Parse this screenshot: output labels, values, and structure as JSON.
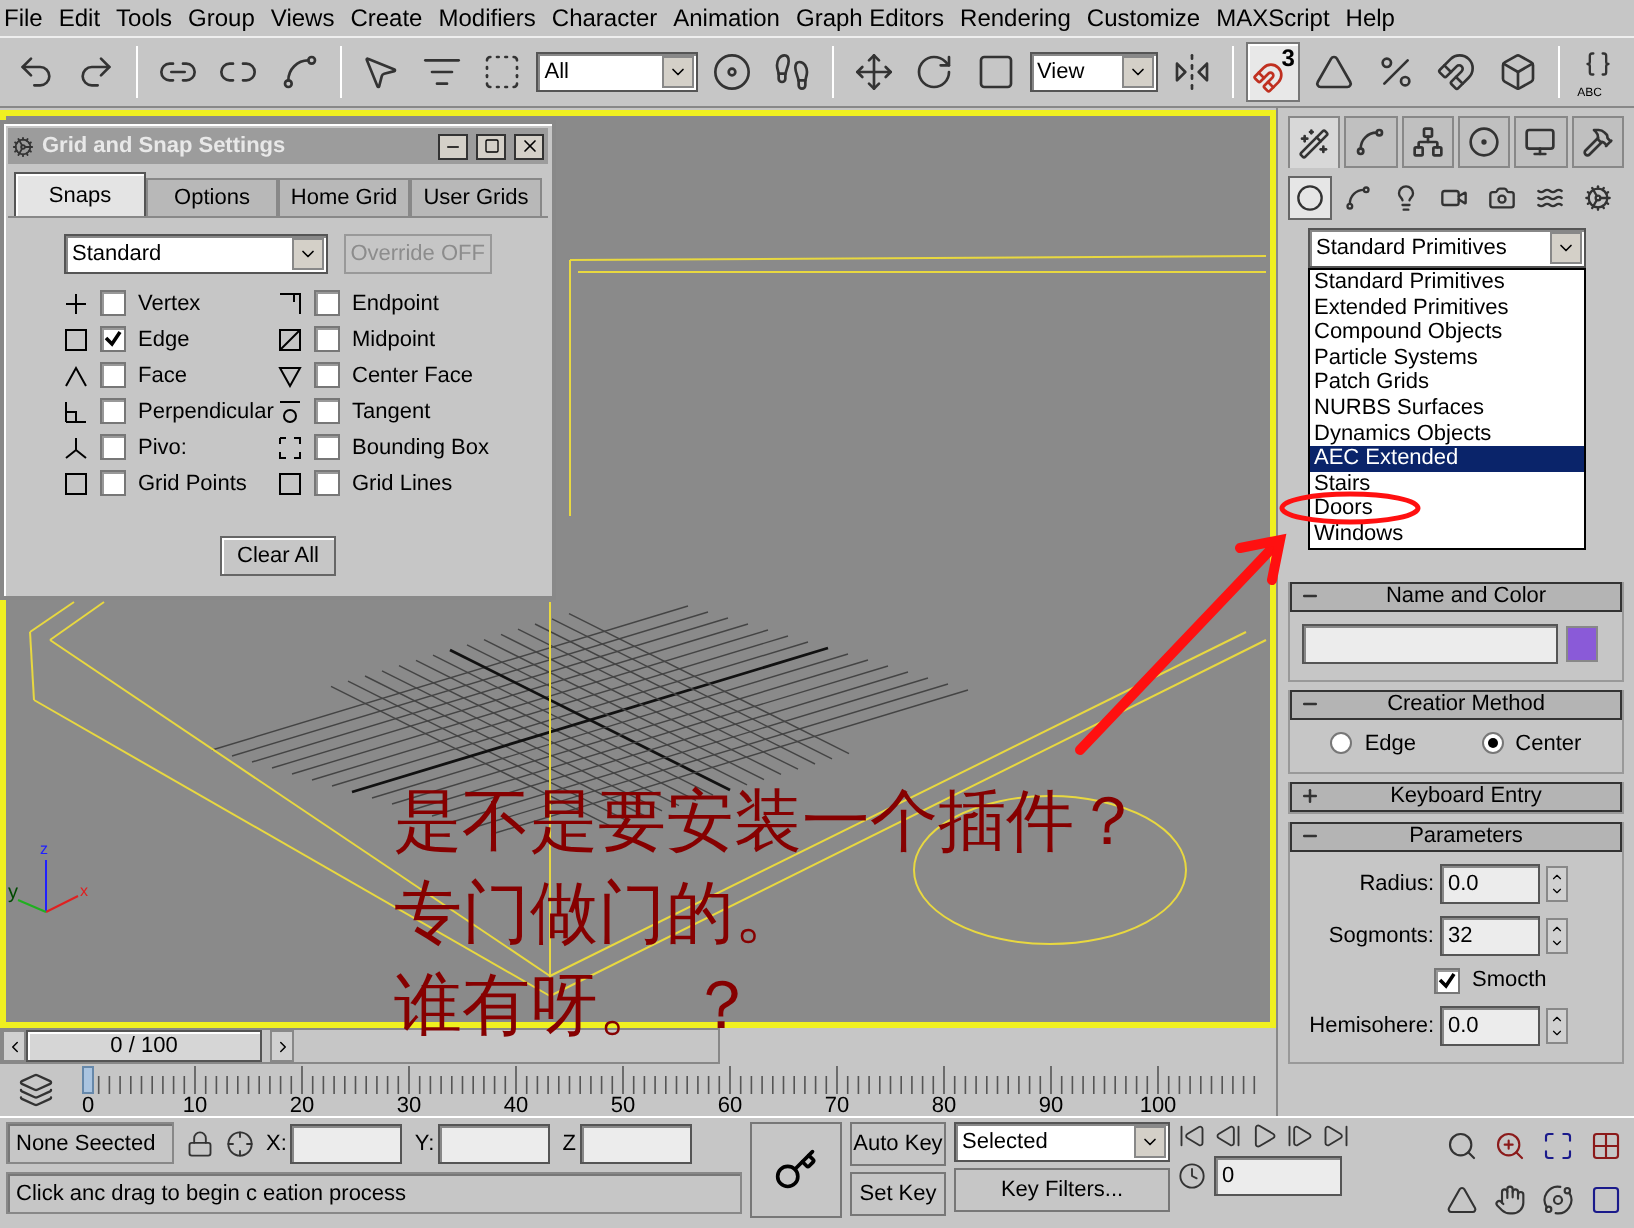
{
  "menu": [
    "File",
    "Edit",
    "Tools",
    "Group",
    "Views",
    "Create",
    "Modifiers",
    "Character",
    "Animation",
    "Graph Editors",
    "Rendering",
    "Customize",
    "MAXScript",
    "Help"
  ],
  "toolbar": {
    "selection_filter": "All",
    "coordinate_system": "View",
    "snap_toggle": {
      "label": "3",
      "on": true
    },
    "named_selection_label": "ABC"
  },
  "viewport": {
    "active": true,
    "axis_labels": [
      "z",
      "y",
      "x"
    ]
  },
  "annotation": {
    "lines": [
      "是不是要安装一个插件？",
      "专门做门的。",
      "谁有呀。 ？"
    ]
  },
  "dialog": {
    "title": "Grid and Snap Settings",
    "tabs": [
      {
        "label": "Snaps",
        "selected": true
      },
      {
        "label": "Options",
        "selected": false
      },
      {
        "label": "Home Grid",
        "selected": false
      },
      {
        "label": "User Grids",
        "selected": false
      }
    ],
    "preset": "Standard",
    "override": {
      "label": "Override OFF",
      "disabled": true
    },
    "snaps": [
      {
        "label": "Vertex",
        "checked": false
      },
      {
        "label": "Endpoint",
        "checked": false
      },
      {
        "label": "Edge",
        "checked": true
      },
      {
        "label": "Midpoint",
        "checked": false
      },
      {
        "label": "Face",
        "checked": false
      },
      {
        "label": "Center Face",
        "checked": false
      },
      {
        "label": "Perpendicular",
        "checked": false
      },
      {
        "label": "Tangent",
        "checked": false
      },
      {
        "label": "Pivo:",
        "checked": false
      },
      {
        "label": "Bounding Box",
        "checked": false
      },
      {
        "label": "Grid Points",
        "checked": false
      },
      {
        "label": "Grid Lines",
        "checked": false
      }
    ],
    "clear_button": "Clear All"
  },
  "command_panel": {
    "tabs": [
      {
        "selected": true
      },
      {
        "selected": false
      },
      {
        "selected": false
      },
      {
        "selected": false
      },
      {
        "selected": false
      },
      {
        "selected": false
      }
    ],
    "categories": [
      {
        "selected": true
      },
      {
        "selected": false
      },
      {
        "selected": false
      },
      {
        "selected": false
      },
      {
        "selected": false
      },
      {
        "selected": false
      },
      {
        "selected": false
      }
    ],
    "category_select": "Standard Primitives",
    "category_list": [
      {
        "label": "Standard Primitives",
        "selected": false
      },
      {
        "label": "Extended Primitives",
        "selected": false
      },
      {
        "label": "Compound Objects",
        "selected": false
      },
      {
        "label": "Particle Systems",
        "selected": false
      },
      {
        "label": "Patch Grids",
        "selected": false
      },
      {
        "label": "NURBS Surfaces",
        "selected": false
      },
      {
        "label": "Dynamics Objects",
        "selected": false
      },
      {
        "label": "AEC Extended",
        "selected": true
      },
      {
        "label": "Stairs",
        "selected": false
      },
      {
        "label": "Doors",
        "selected": false
      },
      {
        "label": "Windows",
        "selected": false
      }
    ],
    "rollouts": [
      {
        "kind": "name_color",
        "title": "Name and Color",
        "expanded": true
      },
      {
        "kind": "creation_method",
        "title": "Creatior Method",
        "expanded": true,
        "options": [
          {
            "label": "Edge",
            "selected": false
          },
          {
            "label": "Center",
            "selected": true
          }
        ]
      },
      {
        "kind": "keyboard_entry",
        "title": "Keyboard Entry",
        "expanded": false
      },
      {
        "kind": "parameters",
        "title": "Parameters",
        "expanded": true,
        "fields": [
          {
            "kind": "spinner",
            "label": "Radius:",
            "value": "0.0"
          },
          {
            "kind": "spinner",
            "label": "Sogmonts:",
            "value": "32"
          },
          {
            "kind": "checkbox",
            "label": "Smocth",
            "checked": true
          },
          {
            "kind": "spinner",
            "label": "Hemisohere:",
            "value": "0.0"
          }
        ]
      }
    ]
  },
  "time_slider": {
    "label": "0 / 100",
    "level": 0
  },
  "ruler": {
    "labels": [
      "0",
      "10",
      "20",
      "30",
      "40",
      "50",
      "60",
      "70",
      "80",
      "90",
      "100"
    ]
  },
  "status": {
    "selection": "None Seected",
    "coords": [
      {
        "label": "X:"
      },
      {
        "label": "Y:"
      },
      {
        "label": "Z"
      }
    ],
    "prompt": "Click anc drag to begin c eation process",
    "auto_key": "Auto Key",
    "set_key": "Set Key",
    "key_mode": "Selected",
    "key_filters": "Key Filters...",
    "frame": "0"
  }
}
